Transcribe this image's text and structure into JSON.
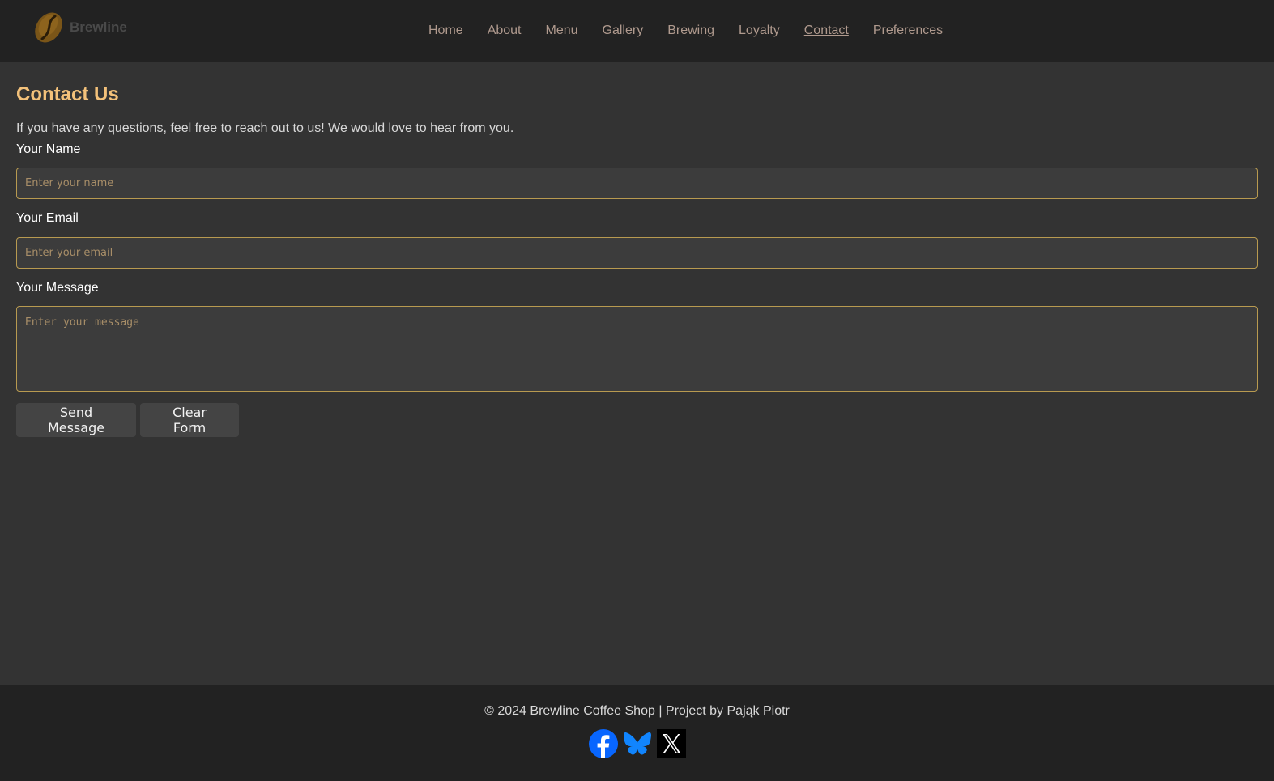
{
  "brand": {
    "name": "Brewline",
    "logo_icon": "coffee-bean-icon"
  },
  "nav": {
    "items": [
      {
        "label": "Home"
      },
      {
        "label": "About"
      },
      {
        "label": "Menu"
      },
      {
        "label": "Gallery"
      },
      {
        "label": "Brewing"
      },
      {
        "label": "Loyalty"
      },
      {
        "label": "Contact",
        "active": true
      },
      {
        "label": "Preferences"
      }
    ]
  },
  "contact": {
    "title": "Contact Us",
    "intro": "If you have any questions, feel free to reach out to us! We would love to hear from you.",
    "name_label": "Your Name",
    "name_placeholder": "Enter your name",
    "email_label": "Your Email",
    "email_placeholder": "Enter your email",
    "message_label": "Your Message",
    "message_placeholder": "Enter your message",
    "send_label": "Send Message",
    "clear_label": "Clear Form"
  },
  "footer": {
    "copyright": "© 2024 Brewline Coffee Shop | Project by Pająk Piotr",
    "socials": [
      "facebook-icon",
      "bluesky-icon",
      "x-icon"
    ]
  },
  "colors": {
    "heading": "#f3c17a",
    "field_border": "#b89a50",
    "facebook": "#0866ff",
    "bluesky": "#1185fe"
  }
}
